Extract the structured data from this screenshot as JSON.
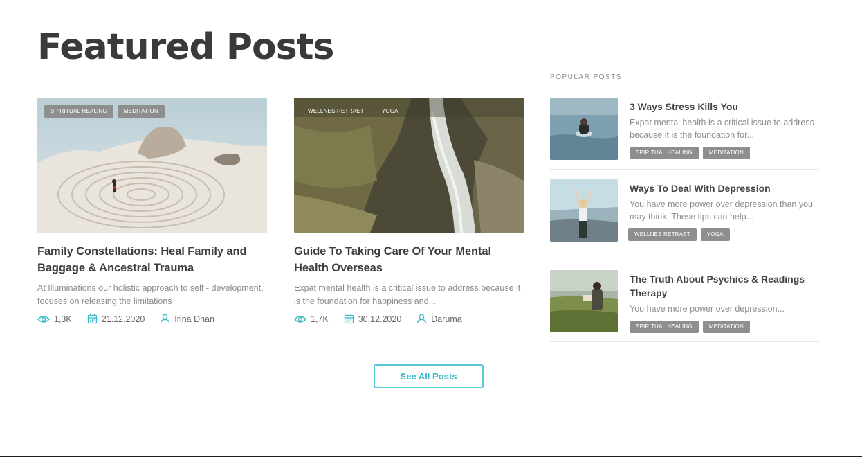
{
  "section": {
    "title": "Featured Posts"
  },
  "featured_posts": [
    {
      "tags": [
        "SPIRITUAL HEALING",
        "MEDITATION"
      ],
      "title": "Family Constellations: Heal Family and Baggage & Ancestral Trauma",
      "excerpt": "At Illuminations our holistic approach to self - development, focuses on releasing the limitations",
      "views": "1,3K",
      "date": "21.12.2020",
      "author": "Irina Dhan"
    },
    {
      "tags": [
        "WELLNES RETRAET",
        "YOGA"
      ],
      "title": "Guide To Taking Care Of Your Mental Health Overseas",
      "excerpt": "Expat mental health is a critical issue to address because it is the foundation for happiness and...",
      "views": "1,7K",
      "date": "30.12.2020",
      "author": "Daruma"
    }
  ],
  "see_all": {
    "label": "See All Posts"
  },
  "popular": {
    "heading": "POPULAR POSTS",
    "items": [
      {
        "title": "3 Ways Stress Kills You",
        "excerpt": "Expat mental health is a critical issue to address because it is the foundation for...",
        "tags": [
          "SPIRITUAL HEALING",
          "MEDITATION"
        ]
      },
      {
        "title": "Ways To Deal With Depression",
        "excerpt": "You have more power over depression than you may think. These tips can help...",
        "tags": [
          "WELLNES RETRAET",
          "YOGA"
        ]
      },
      {
        "title": "The Truth About Psychics & Readings Therapy",
        "excerpt": "You have more power over depression...",
        "tags": [
          "SPIRITUAL HEALING",
          "MEDITATION"
        ]
      }
    ]
  },
  "icons": {
    "views": "eye-icon",
    "date": "calendar-icon",
    "author": "user-icon"
  },
  "colors": {
    "accent": "#39b8c8",
    "tag_bg": "#8e8e8e",
    "heading": "#3a3a3a",
    "text_muted": "#8a8a8a"
  }
}
